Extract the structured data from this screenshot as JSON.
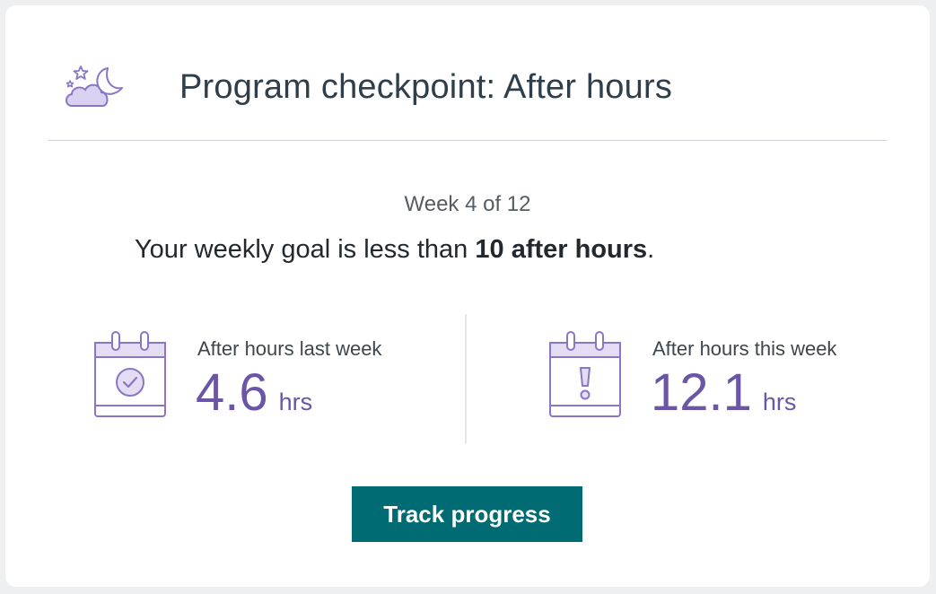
{
  "header": {
    "title": "Program checkpoint: After hours",
    "icon": "moon-cloud-stars-icon"
  },
  "progress": {
    "week_label": "Week 4 of 12",
    "goal_prefix": "Your weekly goal is less than ",
    "goal_emphasis": "10 after hours",
    "goal_suffix": "."
  },
  "stats": {
    "last_week": {
      "label": "After hours last week",
      "value": "4.6",
      "unit": "hrs",
      "icon": "calendar-check-icon"
    },
    "this_week": {
      "label": "After hours this week",
      "value": "12.1",
      "unit": "hrs",
      "icon": "calendar-alert-icon"
    }
  },
  "actions": {
    "track_progress_label": "Track progress"
  },
  "colors": {
    "accent_purple": "#6a55a6",
    "icon_fill": "#e3ddf3",
    "button_teal": "#006b73"
  }
}
